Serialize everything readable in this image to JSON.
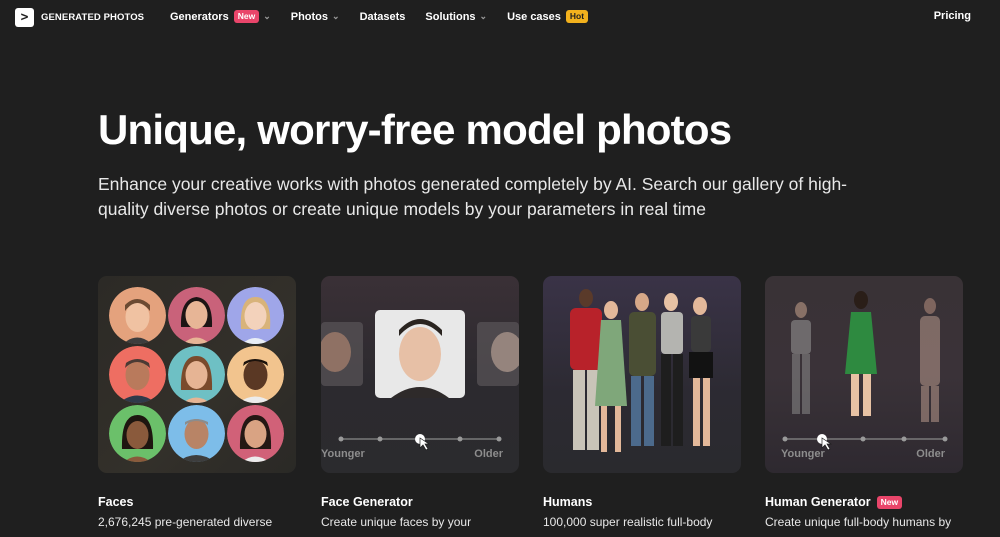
{
  "nav": {
    "logo_text": "GENERATED PHOTOS",
    "logo_symbol": ">",
    "items": [
      {
        "label": "Generators",
        "badge": "New",
        "dropdown": true
      },
      {
        "label": "Photos",
        "dropdown": true
      },
      {
        "label": "Datasets",
        "dropdown": false
      },
      {
        "label": "Solutions",
        "dropdown": true
      },
      {
        "label": "Use cases",
        "badge": "Hot",
        "dropdown": false
      }
    ],
    "pricing": "Pricing"
  },
  "hero": {
    "title": "Unique, worry-free model photos",
    "subtitle": "Enhance your creative works with photos generated completely by AI. Search our gallery of high-quality diverse photos or create unique models by your parameters in real time"
  },
  "cards": [
    {
      "title": "Faces",
      "desc": "2,676,245 pre-generated diverse"
    },
    {
      "title": "Face Generator",
      "desc": "Create unique faces by your",
      "slider_left": "Younger",
      "slider_right": "Older"
    },
    {
      "title": "Humans",
      "desc": "100,000 super realistic full-body"
    },
    {
      "title": "Human Generator",
      "badge": "New",
      "desc": "Create unique full-body humans by",
      "slider_left": "Younger",
      "slider_right": "Older"
    }
  ],
  "colors": {
    "badge_new": "#e9456a",
    "badge_hot": "#f2b11d",
    "background": "#1f1f1f"
  }
}
